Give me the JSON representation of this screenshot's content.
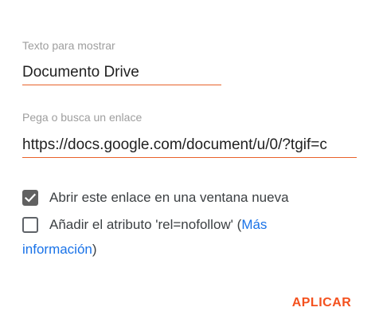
{
  "text_field": {
    "label": "Texto para mostrar",
    "value": "Documento Drive"
  },
  "url_field": {
    "label": "Pega o busca un enlace",
    "value": "https://docs.google.com/document/u/0/?tgif=c"
  },
  "options": {
    "new_window": {
      "label": "Abrir este enlace en una ventana nueva",
      "checked": true
    },
    "nofollow": {
      "label_prefix": "Añadir el atributo 'rel=nofollow' (",
      "link_part1": "Más",
      "link_part2": "información",
      "label_suffix": ")",
      "checked": false
    }
  },
  "actions": {
    "apply_label": "APLICAR"
  },
  "colors": {
    "accent": "#f4511e",
    "link": "#1a73e8",
    "checkbox_checked": "#616161"
  }
}
